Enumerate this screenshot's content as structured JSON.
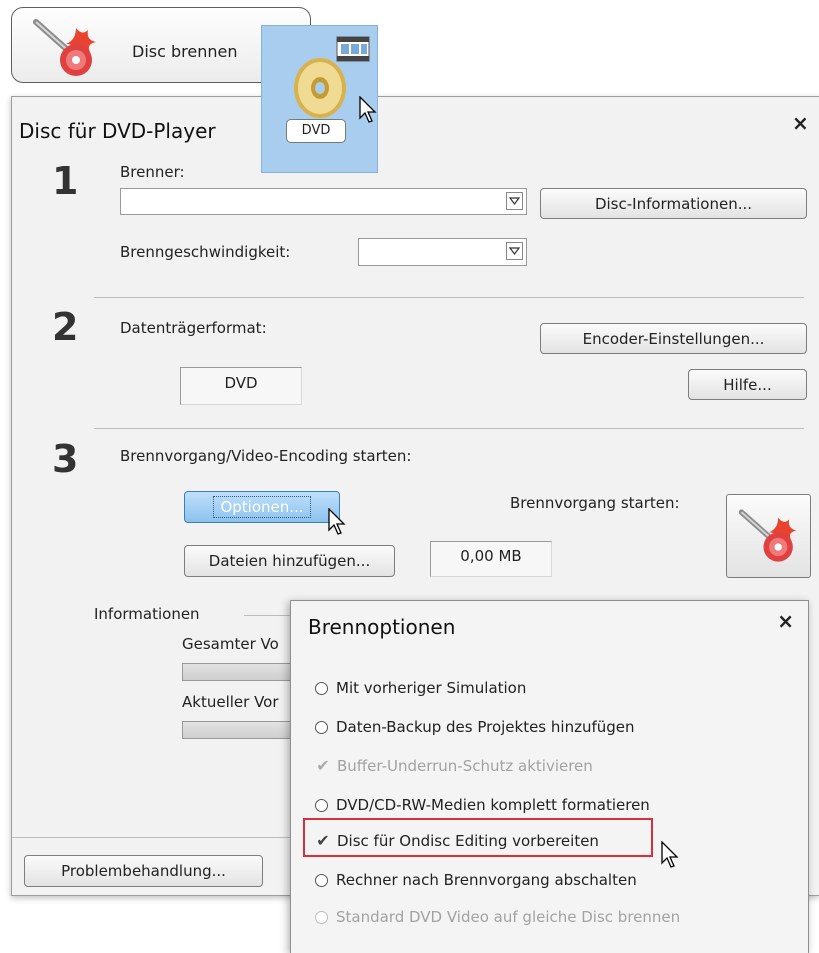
{
  "top_button": {
    "label": "Disc brennen",
    "icon": "burn-disc-icon"
  },
  "dvd_tile": {
    "label": "DVD",
    "icon": "dvd-disc-icon",
    "badge_icon": "film-strip-icon"
  },
  "main_dialog": {
    "title": "Disc für DVD-Player",
    "close": "×",
    "step1": {
      "number": "1",
      "burner_label": "Brenner:",
      "burner_value": "",
      "disc_info_button": "Disc-Informationen...",
      "speed_label": "Brenngeschwindigkeit:",
      "speed_value": ""
    },
    "step2": {
      "number": "2",
      "format_label": "Datenträgerformat:",
      "format_value": "DVD",
      "encoder_button": "Encoder-Einstellungen...",
      "help_button": "Hilfe..."
    },
    "step3": {
      "number": "3",
      "heading": "Brennvorgang/Video-Encoding starten:",
      "options_button": "Optionen...",
      "add_files_button": "Dateien hinzufügen...",
      "size_value": "0,00 MB",
      "start_label": "Brennvorgang starten:",
      "start_icon": "burn-disc-icon"
    },
    "info": {
      "heading": "Informationen",
      "total_progress_label": "Gesamter Vo",
      "current_progress_label": "Aktueller Vor"
    },
    "troubleshoot_button": "Problembehandlung..."
  },
  "burn_options": {
    "title": "Brennoptionen",
    "close": "×",
    "options": [
      {
        "label": "Mit vorheriger Simulation",
        "control": "radio",
        "checked": false,
        "enabled": true
      },
      {
        "label": "Daten-Backup des Projektes hinzufügen",
        "control": "radio",
        "checked": false,
        "enabled": true
      },
      {
        "label": "Buffer-Underrun-Schutz aktivieren",
        "control": "check",
        "checked": true,
        "enabled": false
      },
      {
        "label": "DVD/CD-RW-Medien komplett formatieren",
        "control": "radio",
        "checked": false,
        "enabled": true
      },
      {
        "label": "Disc für Ondisc Editing vorbereiten",
        "control": "check",
        "checked": true,
        "enabled": true,
        "highlighted": true
      },
      {
        "label": "Rechner nach Brennvorgang abschalten",
        "control": "radio",
        "checked": false,
        "enabled": true
      },
      {
        "label": "Standard DVD Video auf gleiche Disc brennen",
        "control": "radio",
        "checked": false,
        "enabled": false
      }
    ]
  },
  "colors": {
    "highlight_border": "#d8303a",
    "selected_button": "#9ccaf2",
    "dvd_tile_bg": "#a9cdef"
  }
}
